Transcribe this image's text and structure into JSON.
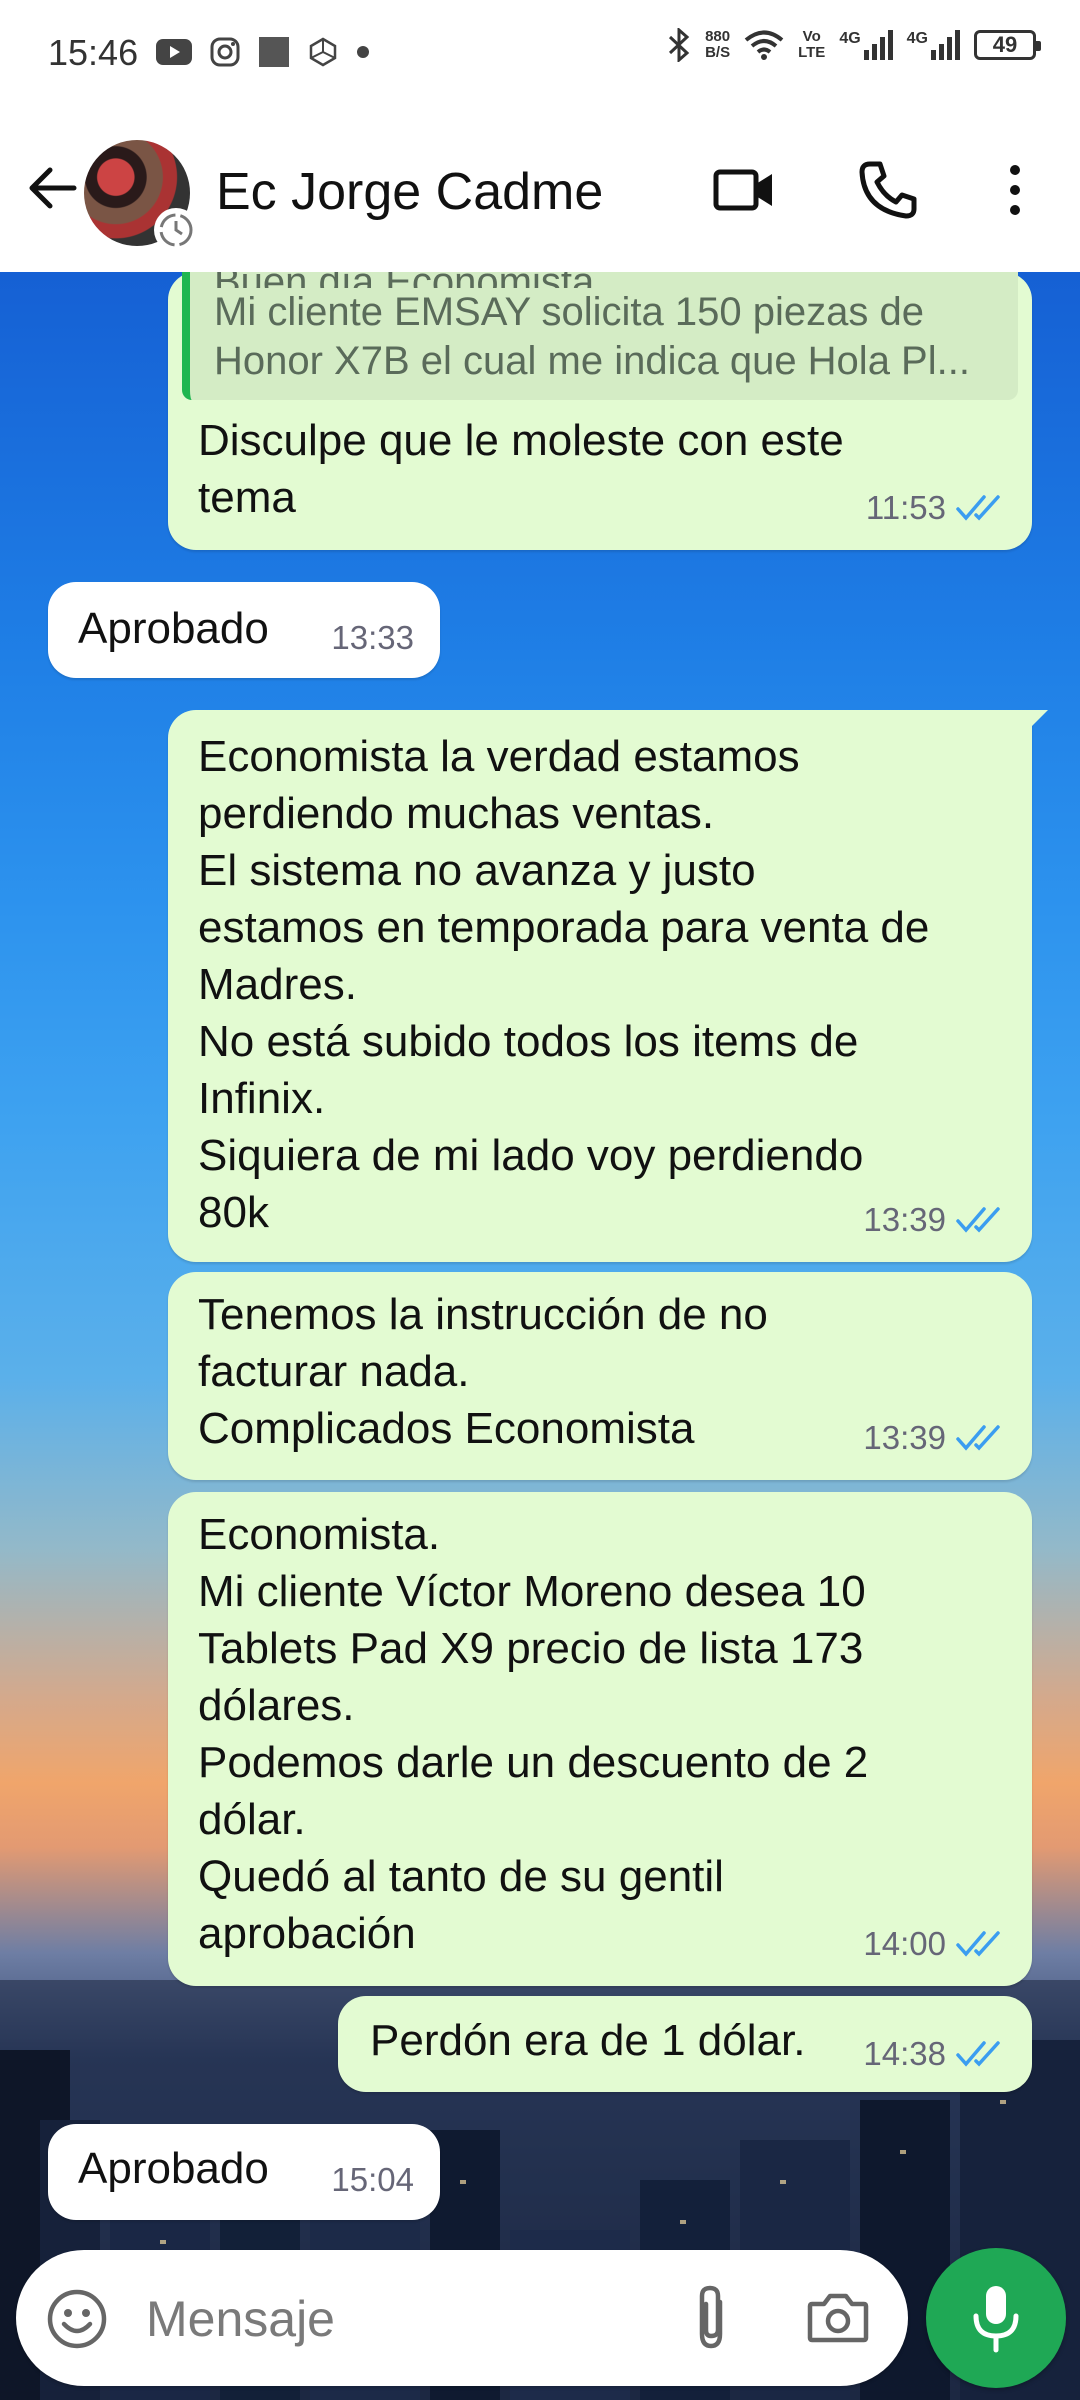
{
  "status_bar": {
    "time": "15:46",
    "net_speed_value": "880",
    "net_speed_unit": "B/S",
    "volte_top": "Vo",
    "volte_bottom": "LTE",
    "signal1_label": "4G",
    "signal2_label": "4G",
    "battery": "49"
  },
  "header": {
    "contact_name": "Ec Jorge Cadme"
  },
  "messages": [
    {
      "direction": "outgoing",
      "quote_hidden": "Buen día Economista.",
      "quote_visible": "Mi cliente EMSAY solicita 150 piezas de\nHonor X7B el cual me indica que Hola Pl...",
      "text": "Disculpe que le moleste con este\ntema",
      "time": "11:53"
    },
    {
      "direction": "incoming",
      "text": "Aprobado",
      "time": "13:33"
    },
    {
      "direction": "outgoing",
      "text": "Economista la verdad estamos\nperdiendo muchas ventas.\nEl sistema no avanza y justo\nestamos en temporada para venta de\nMadres.\nNo está subido todos los items de\nInfinix.\nSiquiera de mi lado voy perdiendo\n80k",
      "time": "13:39"
    },
    {
      "direction": "outgoing",
      "text": "Tenemos la instrucción de no\nfacturar nada.\nComplicados Economista",
      "time": "13:39"
    },
    {
      "direction": "outgoing",
      "text": "Economista.\nMi cliente Víctor Moreno desea 10\nTablets Pad X9 precio de lista 173\ndólares.\nPodemos darle un descuento de 2\ndólar.\nQuedó al tanto de su gentil\naprobación",
      "time": "14:00"
    },
    {
      "direction": "outgoing",
      "text": "Perdón era de 1 dólar.",
      "time": "14:38"
    },
    {
      "direction": "incoming",
      "text": "Aprobado",
      "time": "15:04"
    }
  ],
  "composer": {
    "placeholder": "Mensaje"
  },
  "colors": {
    "outgoing_bubble": "#e3fbd2",
    "incoming_bubble": "#ffffff",
    "read_tick": "#3b9df0",
    "mic_button": "#1fa855",
    "quote_bar": "#1fb650"
  },
  "icons": [
    "youtube-icon",
    "instagram-icon",
    "square-app-icon",
    "bluetooth-icon",
    "wifi-icon",
    "signal-icon",
    "back-arrow-icon",
    "video-call-icon",
    "phone-icon",
    "more-vertical-icon",
    "emoji-icon",
    "attach-icon",
    "camera-icon",
    "mic-icon",
    "double-check-icon"
  ]
}
